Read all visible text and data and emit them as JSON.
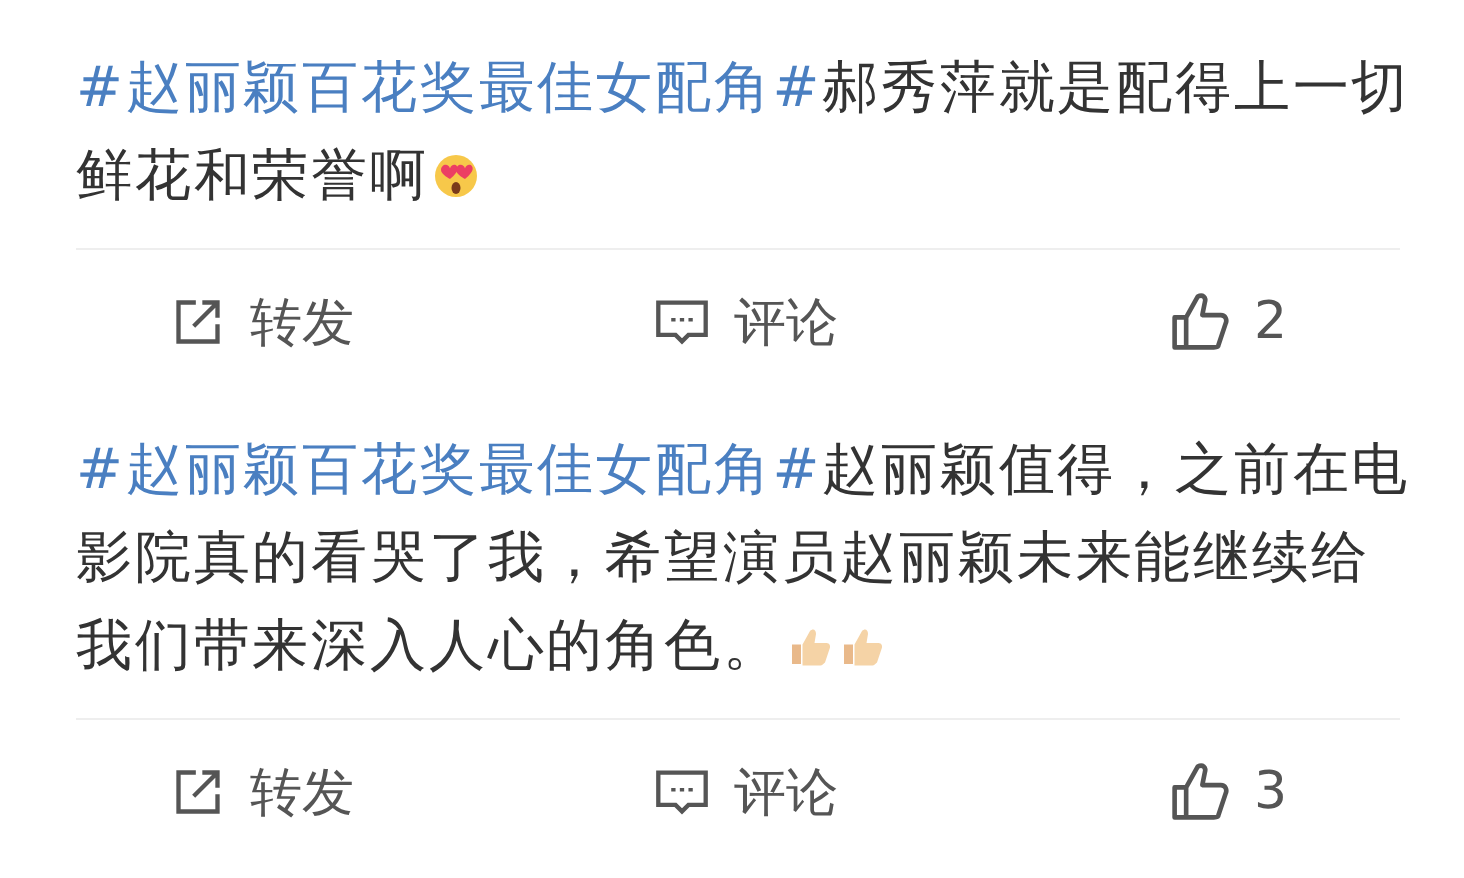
{
  "posts": [
    {
      "hashtag": "#赵丽颖百花奖最佳女配角#",
      "text": "郝秀萍就是配得上一切鲜花和荣誉啊",
      "emojis": [
        {
          "kind": "heart-eyes"
        }
      ],
      "actions": {
        "repost": "转发",
        "comment": "评论",
        "likes": "2"
      }
    },
    {
      "hashtag": "#赵丽颖百花奖最佳女配角#",
      "text": "赵丽颖值得，之前在电影院真的看哭了我，希望演员赵丽颖未来能继续给我们带来深入人心的角色。",
      "emojis": [
        {
          "kind": "thumbs-up"
        },
        {
          "kind": "thumbs-up"
        }
      ],
      "actions": {
        "repost": "转发",
        "comment": "评论",
        "likes": "3"
      }
    }
  ]
}
